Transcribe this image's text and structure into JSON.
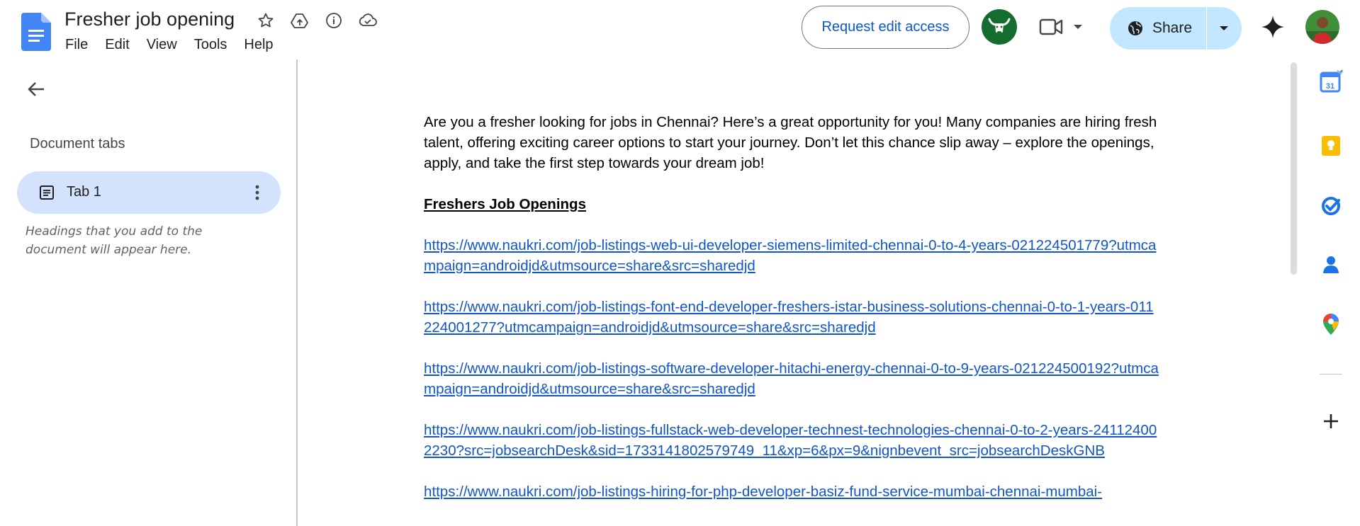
{
  "app": {
    "title": "Fresher job opening",
    "menu": [
      "File",
      "Edit",
      "View",
      "Tools",
      "Help"
    ],
    "title_icons": [
      "star-icon",
      "move-to-drive-icon",
      "info-icon",
      "cloud-saved-icon"
    ]
  },
  "toolbar": {
    "request_edit_label": "Request edit access",
    "share_label": "Share"
  },
  "colors": {
    "accent": "#0b57d0",
    "share_bg": "#c2e7ff",
    "tab_active_bg": "#d3e3fd",
    "link": "#1155cc",
    "avatar_bg": "#146c2e"
  },
  "sidebar": {
    "heading": "Document tabs",
    "tabs": [
      {
        "label": "Tab 1"
      }
    ],
    "hint": "Headings that you add to the document will appear here."
  },
  "document": {
    "intro": "Are you a fresher looking for jobs in Chennai? Here’s a great opportunity for you! Many companies are hiring fresh talent, offering exciting career options to start your journey. Don’t let this chance slip away – explore the openings, apply, and take the first step towards your dream job!",
    "heading": "Freshers Job Openings",
    "links": [
      "https://www.naukri.com/job-listings-web-ui-developer-siemens-limited-chennai-0-to-4-years-021224501779?utmcampaign=androidjd&utmsource=share&src=sharedjd",
      "https://www.naukri.com/job-listings-font-end-developer-freshers-istar-business-solutions-chennai-0-to-1-years-011224001277?utmcampaign=androidjd&utmsource=share&src=sharedjd",
      "https://www.naukri.com/job-listings-software-developer-hitachi-energy-chennai-0-to-9-years-021224500192?utmcampaign=androidjd&utmsource=share&src=sharedjd",
      "https://www.naukri.com/job-listings-fullstack-web-developer-technest-technologies-chennai-0-to-2-years-241124002230?src=jobsearchDesk&sid=1733141802579749_11&xp=6&px=9&nignbevent_src=jobsearchDeskGNB",
      "https://www.naukri.com/job-listings-hiring-for-php-developer-basiz-fund-service-mumbai-chennai-mumbai-"
    ]
  },
  "side_panel": {
    "icons": [
      "calendar-icon",
      "keep-icon",
      "tasks-icon",
      "contacts-icon",
      "maps-icon",
      "add-icon"
    ]
  }
}
